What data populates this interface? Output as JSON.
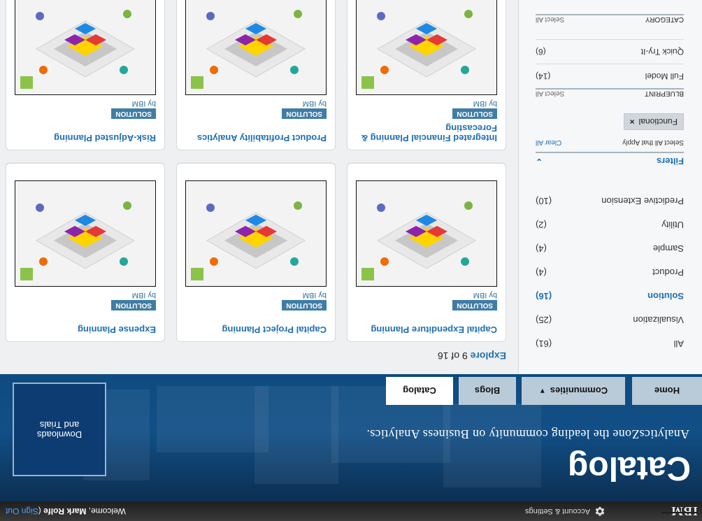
{
  "topbar": {
    "brand": "IBM",
    "account_settings": "Account & Settings",
    "welcome_prefix": "Welcome, ",
    "user_name": "Mark Rolfe",
    "signout_prefix": " (",
    "signout_label": "Sign Out"
  },
  "banner": {
    "title": "Catalog",
    "subtitle": "AnalyticsZone the leading community on Business Analytics.",
    "downloads_label": "Downloads\nand Trials"
  },
  "nav": {
    "tabs": [
      {
        "label": "Home"
      },
      {
        "label": "Communities"
      },
      {
        "label": "Blogs"
      },
      {
        "label": "Catalog"
      }
    ]
  },
  "left": {
    "categories": [
      {
        "label": "All",
        "count": "(61)"
      },
      {
        "label": "Visualization",
        "count": "(25)"
      },
      {
        "label": "Solution",
        "count": "(16)",
        "active": true
      },
      {
        "label": "Product",
        "count": "(4)"
      },
      {
        "label": "Sample",
        "count": "(4)"
      },
      {
        "label": "Utility",
        "count": "(2)"
      },
      {
        "label": "Predictive Extension",
        "count": "(10)"
      }
    ],
    "filters": {
      "title": "Filters",
      "select_all_apply": "Select All that Apply",
      "clear_all": "Clear All",
      "chip_label": "Functional",
      "groups": [
        {
          "title": "BLUEPRINT",
          "select_all": "Select All",
          "rows": [
            {
              "label": "Full Model",
              "count": "(14)"
            },
            {
              "label": "Quick Try-It",
              "count": "(6)"
            }
          ]
        },
        {
          "title": "CATEGORY",
          "select_all": "Select All",
          "rows": []
        }
      ]
    }
  },
  "content": {
    "explore_label": "Explore",
    "explore_range": "9 of 16",
    "cards": [
      {
        "title": "Capital Expenditure Planning",
        "badge": "SOLUTION",
        "by": "by IBM"
      },
      {
        "title": "Capital Project Planning",
        "badge": "SOLUTION",
        "by": "by IBM"
      },
      {
        "title": "Expense Planning",
        "badge": "SOLUTION",
        "by": "by IBM"
      },
      {
        "title": "Integrated Financial Planning & Forecasting",
        "badge": "SOLUTION",
        "by": "by IBM"
      },
      {
        "title": "Product Profitability Analytics",
        "badge": "SOLUTION",
        "by": "by IBM"
      },
      {
        "title": "Risk-Adjusted Planning",
        "badge": "SOLUTION",
        "by": "by IBM"
      }
    ]
  }
}
